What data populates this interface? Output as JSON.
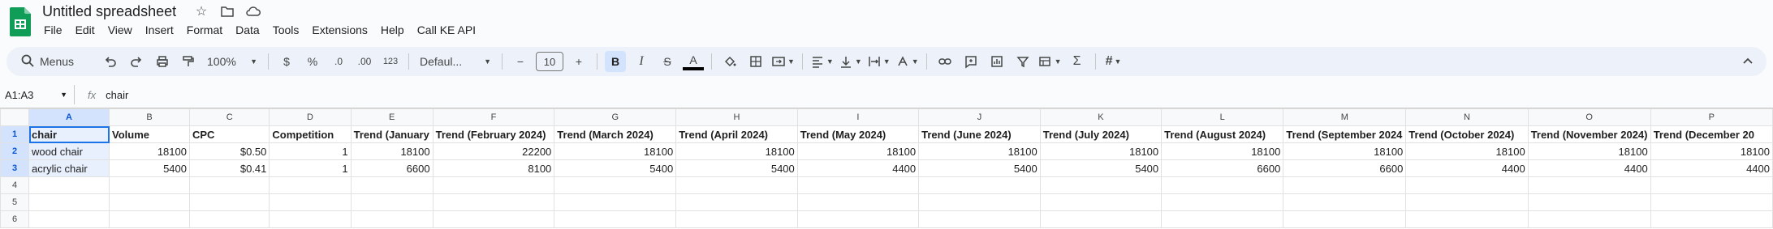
{
  "app": {
    "title": "Untitled spreadsheet"
  },
  "menu": [
    "File",
    "Edit",
    "View",
    "Insert",
    "Format",
    "Data",
    "Tools",
    "Extensions",
    "Help",
    "Call KE API"
  ],
  "toolbar": {
    "search_label": "Menus",
    "zoom": "100%",
    "currency": "$",
    "percent": "%",
    "dec_decrease": ".0",
    "dec_increase": ".00",
    "number_format": "123",
    "font": "Defaul...",
    "font_size": "10",
    "minus": "−",
    "plus": "+",
    "bold": "B",
    "italic": "I",
    "strike": "S",
    "text_color": "A",
    "sum": "Σ"
  },
  "formula_bar": {
    "name_box": "A1:A3",
    "fx": "fx",
    "content": "chair"
  },
  "columns": [
    "A",
    "B",
    "C",
    "D",
    "E",
    "F",
    "G",
    "H",
    "I",
    "J",
    "K",
    "L",
    "M",
    "N",
    "O",
    "P"
  ],
  "rows": [
    "1",
    "2",
    "3",
    "4",
    "5",
    "6"
  ],
  "cells": [
    [
      "chair",
      "Volume",
      "CPC",
      "Competition",
      "Trend (January",
      "Trend (February 2024)",
      "Trend (March 2024)",
      "Trend (April 2024)",
      "Trend (May 2024)",
      "Trend (June 2024)",
      "Trend (July 2024)",
      "Trend (August 2024)",
      "Trend (September 2024",
      "Trend (October 2024)",
      "Trend (November 2024)",
      "Trend (December 20"
    ],
    [
      "wood chair",
      "18100",
      "$0.50",
      "1",
      "18100",
      "22200",
      "18100",
      "18100",
      "18100",
      "18100",
      "18100",
      "18100",
      "18100",
      "18100",
      "18100",
      "18100"
    ],
    [
      "acrylic chair",
      "5400",
      "$0.41",
      "1",
      "6600",
      "8100",
      "5400",
      "5400",
      "4400",
      "5400",
      "5400",
      "6600",
      "6600",
      "4400",
      "4400",
      "4400"
    ],
    [
      "",
      "",
      "",
      "",
      "",
      "",
      "",
      "",
      "",
      "",
      "",
      "",
      "",
      "",
      "",
      ""
    ],
    [
      "",
      "",
      "",
      "",
      "",
      "",
      "",
      "",
      "",
      "",
      "",
      "",
      "",
      "",
      "",
      ""
    ],
    [
      "",
      "",
      "",
      "",
      "",
      "",
      "",
      "",
      "",
      "",
      "",
      "",
      "",
      "",
      "",
      ""
    ]
  ]
}
